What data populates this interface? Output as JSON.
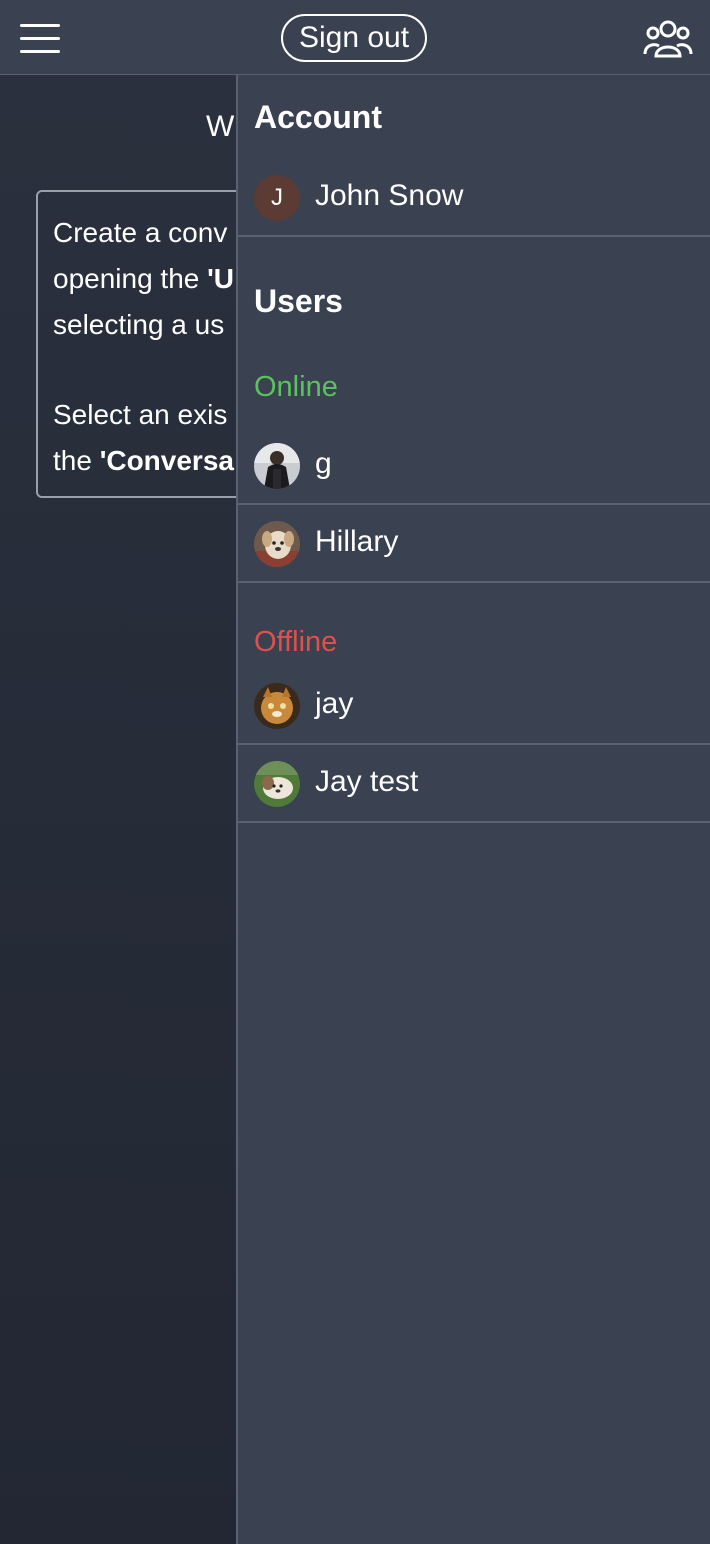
{
  "header": {
    "menu_icon": "hamburger-icon",
    "sign_out_label": "Sign out",
    "users_icon": "users-group-icon"
  },
  "main": {
    "welcome_fragment": "W",
    "info_paragraph_1_prefix": "Create a conv",
    "info_paragraph_1_line2_prefix": "opening the ",
    "info_paragraph_1_line2_bold": "'U",
    "info_paragraph_1_line3": "selecting a us",
    "info_paragraph_2_line1": "Select an exis",
    "info_paragraph_2_line2_prefix": "the ",
    "info_paragraph_2_line2_bold": "'Conversa"
  },
  "drawer": {
    "account_title": "Account",
    "account_user": {
      "initial": "J",
      "name": "John Snow",
      "avatar_color": "#5b3b34"
    },
    "users_title": "Users",
    "online_label": "Online",
    "online_color": "#5cc160",
    "online_users": [
      {
        "name": "g",
        "avatar": "photo-avatar-person"
      },
      {
        "name": "Hillary",
        "avatar": "photo-avatar-dog"
      }
    ],
    "offline_label": "Offline",
    "offline_color": "#e0504a",
    "offline_users": [
      {
        "name": "jay",
        "avatar": "photo-avatar-cat"
      },
      {
        "name": "Jay test",
        "avatar": "photo-avatar-dog-grass"
      }
    ]
  }
}
